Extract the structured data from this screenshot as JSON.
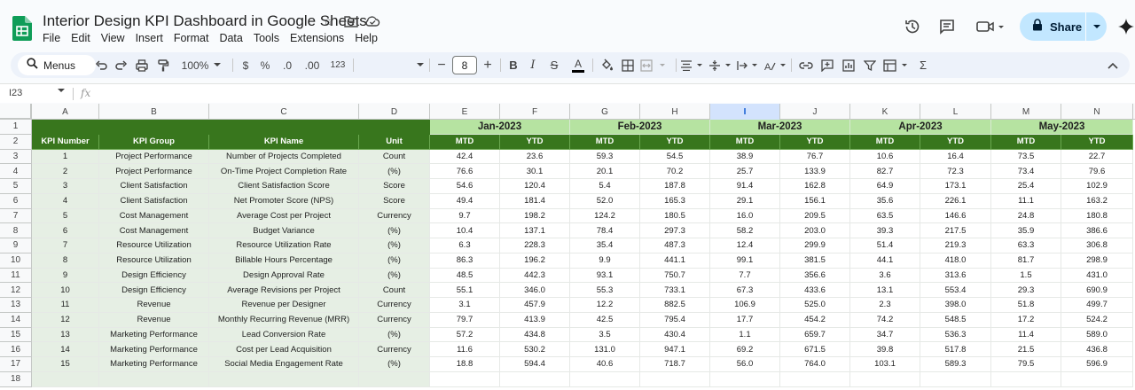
{
  "app": {
    "title": "Interior Design KPI Dashboard in Google Sheets",
    "menu": [
      "File",
      "Edit",
      "View",
      "Insert",
      "Format",
      "Data",
      "Tools",
      "Extensions",
      "Help"
    ],
    "share_label": "Share",
    "brand_color": "#0f9d58"
  },
  "toolbar": {
    "menus_label": "Menus",
    "zoom": "100%",
    "currency_symbol": "$",
    "percent_symbol": "%",
    "decrease_decimal": ".0",
    "increase_decimal": ".00",
    "number_format": "123",
    "font_size": "8"
  },
  "formula_bar": {
    "cell_ref": "I23",
    "fx": "fx"
  },
  "grid": {
    "columns": [
      "A",
      "B",
      "C",
      "D",
      "E",
      "F",
      "G",
      "H",
      "I",
      "J",
      "K",
      "L",
      "M",
      "N"
    ],
    "selected_column": "I",
    "rows": [
      "1",
      "2",
      "3",
      "4",
      "5",
      "6",
      "7",
      "8",
      "9",
      "10",
      "11",
      "12",
      "13",
      "14",
      "15",
      "16",
      "17",
      "18"
    ],
    "header_color": "#38761d",
    "month_color": "#b6e3a1",
    "months": [
      "Jan-2023",
      "Feb-2023",
      "Mar-2023",
      "Apr-2023",
      "May-2023"
    ],
    "sub_headers": [
      "MTD",
      "YTD"
    ],
    "kpi_headers": [
      "KPI Number",
      "KPI Group",
      "KPI Name",
      "Unit"
    ],
    "kpis": [
      {
        "num": "1",
        "group": "Project Performance",
        "name": "Number of Projects Completed",
        "unit": "Count",
        "values": [
          "42.4",
          "23.6",
          "59.3",
          "54.5",
          "38.9",
          "76.7",
          "10.6",
          "16.4",
          "73.5",
          "22.7"
        ]
      },
      {
        "num": "2",
        "group": "Project Performance",
        "name": "On-Time Project Completion Rate",
        "unit": "(%)",
        "values": [
          "76.6",
          "30.1",
          "20.1",
          "70.2",
          "25.7",
          "133.9",
          "82.7",
          "72.3",
          "73.4",
          "79.6"
        ]
      },
      {
        "num": "3",
        "group": "Client Satisfaction",
        "name": "Client Satisfaction Score",
        "unit": "Score",
        "values": [
          "54.6",
          "120.4",
          "5.4",
          "187.8",
          "91.4",
          "162.8",
          "64.9",
          "173.1",
          "25.4",
          "102.9"
        ]
      },
      {
        "num": "4",
        "group": "Client Satisfaction",
        "name": "Net Promoter Score (NPS)",
        "unit": "Score",
        "values": [
          "49.4",
          "181.4",
          "52.0",
          "165.3",
          "29.1",
          "156.1",
          "35.6",
          "226.1",
          "11.1",
          "163.2"
        ]
      },
      {
        "num": "5",
        "group": "Cost Management",
        "name": "Average Cost per Project",
        "unit": "Currency",
        "values": [
          "9.7",
          "198.2",
          "124.2",
          "180.5",
          "16.0",
          "209.5",
          "63.5",
          "146.6",
          "24.8",
          "180.8"
        ]
      },
      {
        "num": "6",
        "group": "Cost Management",
        "name": "Budget Variance",
        "unit": "(%)",
        "values": [
          "10.4",
          "137.1",
          "78.4",
          "297.3",
          "58.2",
          "203.0",
          "39.3",
          "217.5",
          "35.9",
          "386.6"
        ]
      },
      {
        "num": "7",
        "group": "Resource Utilization",
        "name": "Resource Utilization Rate",
        "unit": "(%)",
        "values": [
          "6.3",
          "228.3",
          "35.4",
          "487.3",
          "12.4",
          "299.9",
          "51.4",
          "219.3",
          "63.3",
          "306.8"
        ]
      },
      {
        "num": "8",
        "group": "Resource Utilization",
        "name": "Billable Hours Percentage",
        "unit": "(%)",
        "values": [
          "86.3",
          "196.2",
          "9.9",
          "441.1",
          "99.1",
          "381.5",
          "44.1",
          "418.0",
          "81.7",
          "298.9"
        ]
      },
      {
        "num": "9",
        "group": "Design Efficiency",
        "name": "Design Approval Rate",
        "unit": "(%)",
        "values": [
          "48.5",
          "442.3",
          "93.1",
          "750.7",
          "7.7",
          "356.6",
          "3.6",
          "313.6",
          "1.5",
          "431.0"
        ]
      },
      {
        "num": "10",
        "group": "Design Efficiency",
        "name": "Average Revisions per Project",
        "unit": "Count",
        "values": [
          "55.1",
          "346.0",
          "55.3",
          "733.1",
          "67.3",
          "433.6",
          "13.1",
          "553.4",
          "29.3",
          "690.9"
        ]
      },
      {
        "num": "11",
        "group": "Revenue",
        "name": "Revenue per Designer",
        "unit": "Currency",
        "values": [
          "3.1",
          "457.9",
          "12.2",
          "882.5",
          "106.9",
          "525.0",
          "2.3",
          "398.0",
          "51.8",
          "499.7"
        ]
      },
      {
        "num": "12",
        "group": "Revenue",
        "name": "Monthly Recurring Revenue (MRR)",
        "unit": "Currency",
        "values": [
          "79.7",
          "413.9",
          "42.5",
          "795.4",
          "17.7",
          "454.2",
          "74.2",
          "548.5",
          "17.2",
          "524.2"
        ]
      },
      {
        "num": "13",
        "group": "Marketing Performance",
        "name": "Lead Conversion Rate",
        "unit": "(%)",
        "values": [
          "57.2",
          "434.8",
          "3.5",
          "430.4",
          "1.1",
          "659.7",
          "34.7",
          "536.3",
          "11.4",
          "589.0"
        ]
      },
      {
        "num": "14",
        "group": "Marketing Performance",
        "name": "Cost per Lead Acquisition",
        "unit": "Currency",
        "values": [
          "11.6",
          "530.2",
          "131.0",
          "947.1",
          "69.2",
          "671.5",
          "39.8",
          "517.8",
          "21.5",
          "436.8"
        ]
      },
      {
        "num": "15",
        "group": "Marketing Performance",
        "name": "Social Media Engagement Rate",
        "unit": "(%)",
        "values": [
          "18.8",
          "594.4",
          "40.6",
          "718.7",
          "56.0",
          "764.0",
          "103.1",
          "589.3",
          "79.5",
          "596.9"
        ]
      }
    ]
  }
}
